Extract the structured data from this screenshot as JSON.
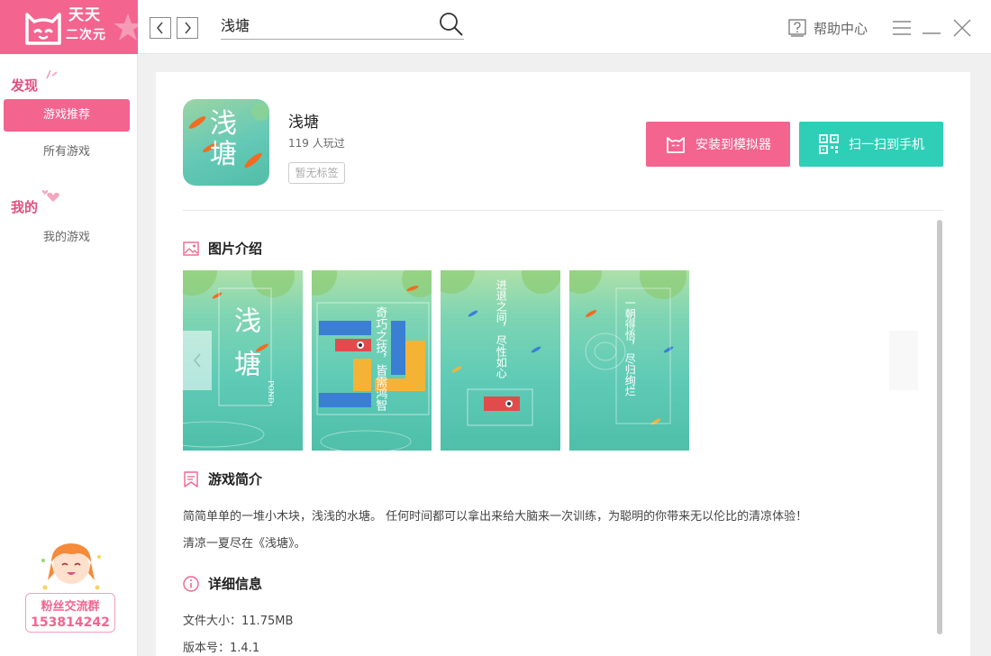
{
  "app": {
    "logo_line1": "天天",
    "logo_line2": "二次元",
    "accent_color": "#f3648f",
    "secondary_color": "#2ecfb6"
  },
  "topbar": {
    "back_icon": "chevron-left-icon",
    "forward_icon": "chevron-right-icon",
    "search_value": "浅塘",
    "help_label": "帮助中心"
  },
  "sidebar": {
    "discover_label": "发现",
    "items": [
      {
        "label": "游戏推荐",
        "active": true
      },
      {
        "label": "所有游戏",
        "active": false
      }
    ],
    "mine_label": "我的",
    "my_items": [
      {
        "label": "我的游戏"
      }
    ],
    "fan_group_label": "粉丝交流群",
    "fan_group_number": "153814242"
  },
  "game": {
    "name": "浅塘",
    "play_count": "119  人玩过",
    "tag": "暂无标签",
    "icon_text_1": "浅",
    "icon_text_2": "塘",
    "install_label": "安装到模拟器",
    "scan_label": "扫一扫到手机"
  },
  "screenshots_section": {
    "title": "图片介绍",
    "shots": [
      {
        "text_a": "浅",
        "text_b": "塘",
        "text_c": "POND"
      },
      {
        "text_a": "奇巧之技，",
        "text_b": "皆需鸿智"
      },
      {
        "text_a": "进退之间，",
        "text_b": "尽性如心"
      },
      {
        "text_a": "一朝得悟，",
        "text_b": "尽归绚烂"
      }
    ]
  },
  "intro_section": {
    "title": "游戏简介",
    "line1": "简简单单的一堆小木块，浅浅的水塘。 任何时间都可以拿出来给大脑来一次训练，为聪明的你带来无以伦比的清凉体验！",
    "line2": "清凉一夏尽在《浅塘》。"
  },
  "detail_section": {
    "title": "详细信息",
    "file_size_label": "文件大小：",
    "file_size": "11.75MB",
    "version_label": "版本号：",
    "version": "1.4.1"
  }
}
